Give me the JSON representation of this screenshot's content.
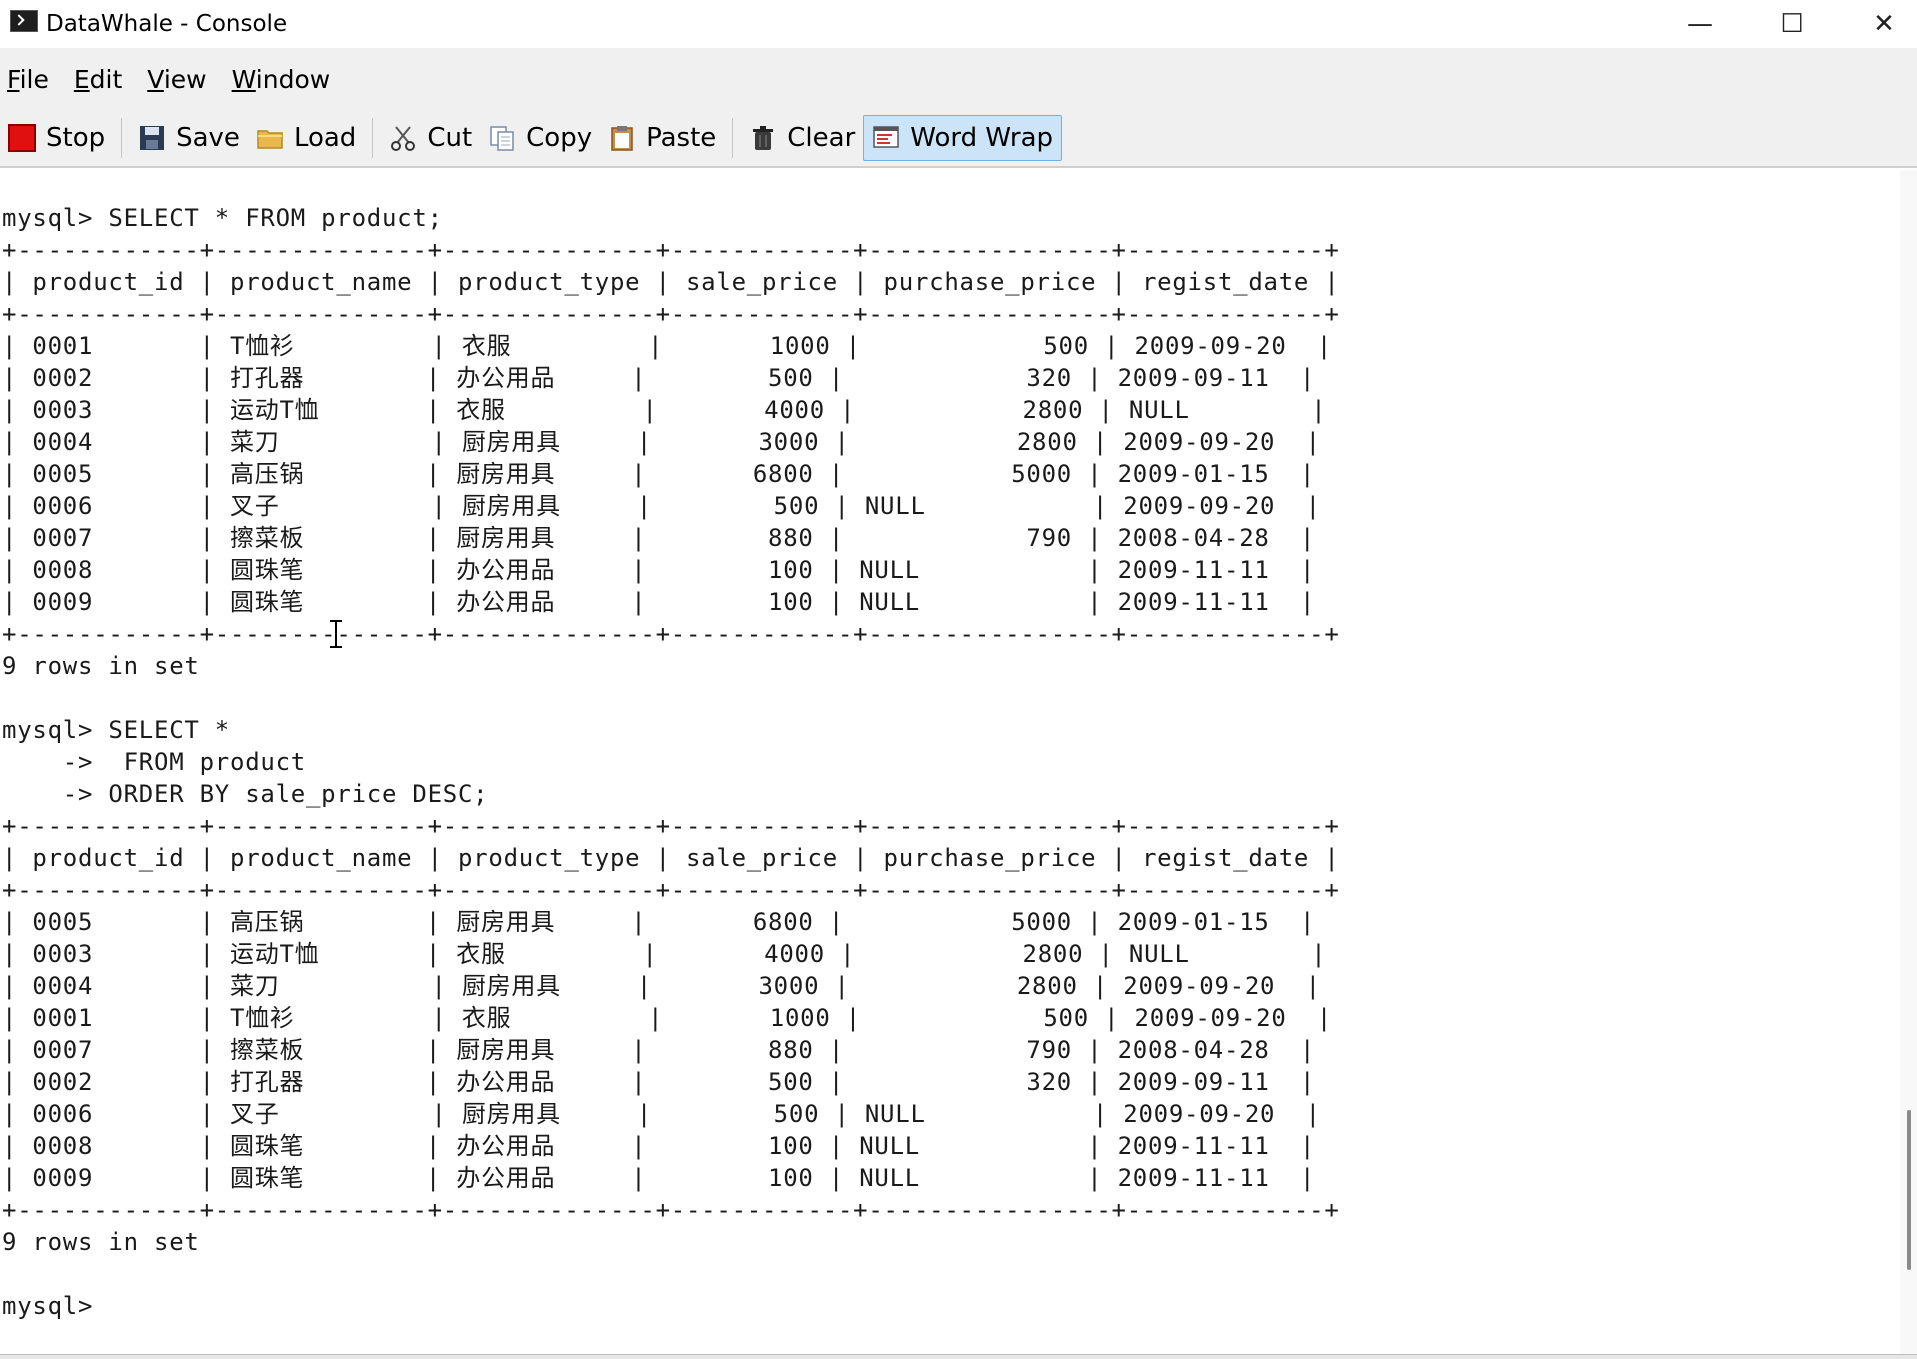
{
  "window": {
    "title": "DataWhale - Console",
    "controls": {
      "minimize": "—",
      "maximize": "☐",
      "close": "✕"
    }
  },
  "menu": [
    "File",
    "Edit",
    "View",
    "Window"
  ],
  "toolbar": {
    "stop": "Stop",
    "save": "Save",
    "load": "Load",
    "cut": "Cut",
    "copy": "Copy",
    "paste": "Paste",
    "clear": "Clear",
    "word_wrap": "Word Wrap"
  },
  "console": {
    "lines": [
      "",
      "mysql> SELECT * FROM product;",
      "+------------+--------------+--------------+------------+----------------+-------------+",
      "| product_id | product_name | product_type | sale_price | purchase_price | regist_date |",
      "+------------+--------------+--------------+------------+----------------+-------------+",
      "| 0001       | T恤衫         | 衣服         |       1000 |            500 | 2009-09-20  |",
      "| 0002       | 打孔器        | 办公用品     |        500 |            320 | 2009-09-11  |",
      "| 0003       | 运动T恤       | 衣服         |       4000 |           2800 | NULL        |",
      "| 0004       | 菜刀          | 厨房用具     |       3000 |           2800 | 2009-09-20  |",
      "| 0005       | 高压锅        | 厨房用具     |       6800 |           5000 | 2009-01-15  |",
      "| 0006       | 叉子          | 厨房用具     |        500 | NULL           | 2009-09-20  |",
      "| 0007       | 擦菜板        | 厨房用具     |        880 |            790 | 2008-04-28  |",
      "| 0008       | 圆珠笔        | 办公用品     |        100 | NULL           | 2009-11-11  |",
      "| 0009       | 圆珠笔        | 办公用品     |        100 | NULL           | 2009-11-11  |",
      "+------------+--------------+--------------+------------+----------------+-------------+",
      "9 rows in set",
      "",
      "mysql> SELECT *",
      "    ->  FROM product",
      "    -> ORDER BY sale_price DESC;",
      "+------------+--------------+--------------+------------+----------------+-------------+",
      "| product_id | product_name | product_type | sale_price | purchase_price | regist_date |",
      "+------------+--------------+--------------+------------+----------------+-------------+",
      "| 0005       | 高压锅        | 厨房用具     |       6800 |           5000 | 2009-01-15  |",
      "| 0003       | 运动T恤       | 衣服         |       4000 |           2800 | NULL        |",
      "| 0004       | 菜刀          | 厨房用具     |       3000 |           2800 | 2009-09-20  |",
      "| 0001       | T恤衫         | 衣服         |       1000 |            500 | 2009-09-20  |",
      "| 0007       | 擦菜板        | 厨房用具     |        880 |            790 | 2008-04-28  |",
      "| 0002       | 打孔器        | 办公用品     |        500 |            320 | 2009-09-11  |",
      "| 0006       | 叉子          | 厨房用具     |        500 | NULL           | 2009-09-20  |",
      "| 0008       | 圆珠笔        | 办公用品     |        100 | NULL           | 2009-11-11  |",
      "| 0009       | 圆珠笔        | 办公用品     |        100 | NULL           | 2009-11-11  |",
      "+------------+--------------+--------------+------------+----------------+-------------+",
      "9 rows in set",
      "",
      "mysql>"
    ]
  }
}
